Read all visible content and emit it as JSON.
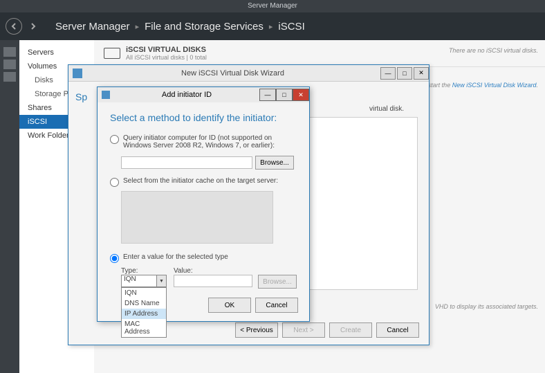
{
  "titlebar": "Server Manager",
  "breadcrumb": {
    "a": "Server Manager",
    "b": "File and Storage Services",
    "c": "iSCSI"
  },
  "sidebar": {
    "items": [
      {
        "label": "Servers"
      },
      {
        "label": "Volumes"
      },
      {
        "label": "Disks"
      },
      {
        "label": "Storage Po..."
      },
      {
        "label": "Shares"
      },
      {
        "label": "iSCSI"
      },
      {
        "label": "Work Folders"
      }
    ]
  },
  "section": {
    "title": "iSCSI VIRTUAL DISKS",
    "sub": "All iSCSI virtual disks | 0 total",
    "hint_right": "There are no iSCSI virtual disks.",
    "hint_link_pre": "disk, start the ",
    "hint_link": "New iSCSI Virtual Disk Wizard",
    "hint_bottom": "VHD to display its associated targets."
  },
  "wizard": {
    "title": "New iSCSI Virtual Disk Wizard",
    "left_label": "Sp",
    "right_heading": "virtual disk.",
    "footer": {
      "prev": "< Previous",
      "next": "Next >",
      "create": "Create",
      "cancel": "Cancel"
    }
  },
  "dialog": {
    "title": "Add initiator ID",
    "heading": "Select a method to identify the initiator:",
    "opt1": "Query initiator computer for ID (not supported on Windows Server 2008 R2, Windows 7, or earlier):",
    "browse": "Browse...",
    "opt2": "Select from the initiator cache on the target server:",
    "opt3": "Enter a value for the selected type",
    "type_label": "Type:",
    "value_label": "Value:",
    "type_selected": "IQN",
    "dropdown": [
      "IQN",
      "DNS Name",
      "IP Address",
      "MAC Address"
    ],
    "ok": "OK",
    "cancel": "Cancel"
  },
  "chart_data": {
    "type": "table",
    "note": "no chart data present"
  }
}
